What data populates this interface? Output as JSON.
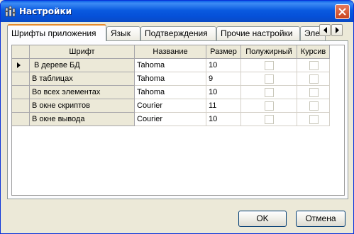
{
  "window": {
    "title": "Настройки",
    "title_icon": "app-settings-icon",
    "close_icon": "close-icon"
  },
  "tabs": [
    {
      "label": "Шрифты приложения",
      "active": true
    },
    {
      "label": "Язык",
      "active": false
    },
    {
      "label": "Подтверждения",
      "active": false
    },
    {
      "label": "Прочие настройки",
      "active": false
    },
    {
      "label": "Элементы",
      "active": false
    }
  ],
  "tab_scroll": {
    "left_icon": "arrow-left-icon",
    "right_icon": "arrow-right-icon"
  },
  "grid": {
    "columns": [
      "Шрифт",
      "Название",
      "Размер",
      "Полужирный",
      "Курсив"
    ],
    "current_row": 0,
    "rows": [
      {
        "font": "В дереве БД",
        "name": "Tahoma",
        "size": "10",
        "bold": false,
        "italic": false
      },
      {
        "font": "В таблицах",
        "name": "Tahoma",
        "size": "9",
        "bold": false,
        "italic": false
      },
      {
        "font": "Во всех элементах",
        "name": "Tahoma",
        "size": "10",
        "bold": false,
        "italic": false
      },
      {
        "font": "В окне скриптов",
        "name": "Courier",
        "size": "11",
        "bold": false,
        "italic": false
      },
      {
        "font": "В окне вывода",
        "name": "Courier",
        "size": "10",
        "bold": false,
        "italic": false
      }
    ]
  },
  "buttons": {
    "ok": "OK",
    "cancel": "Отмена"
  }
}
